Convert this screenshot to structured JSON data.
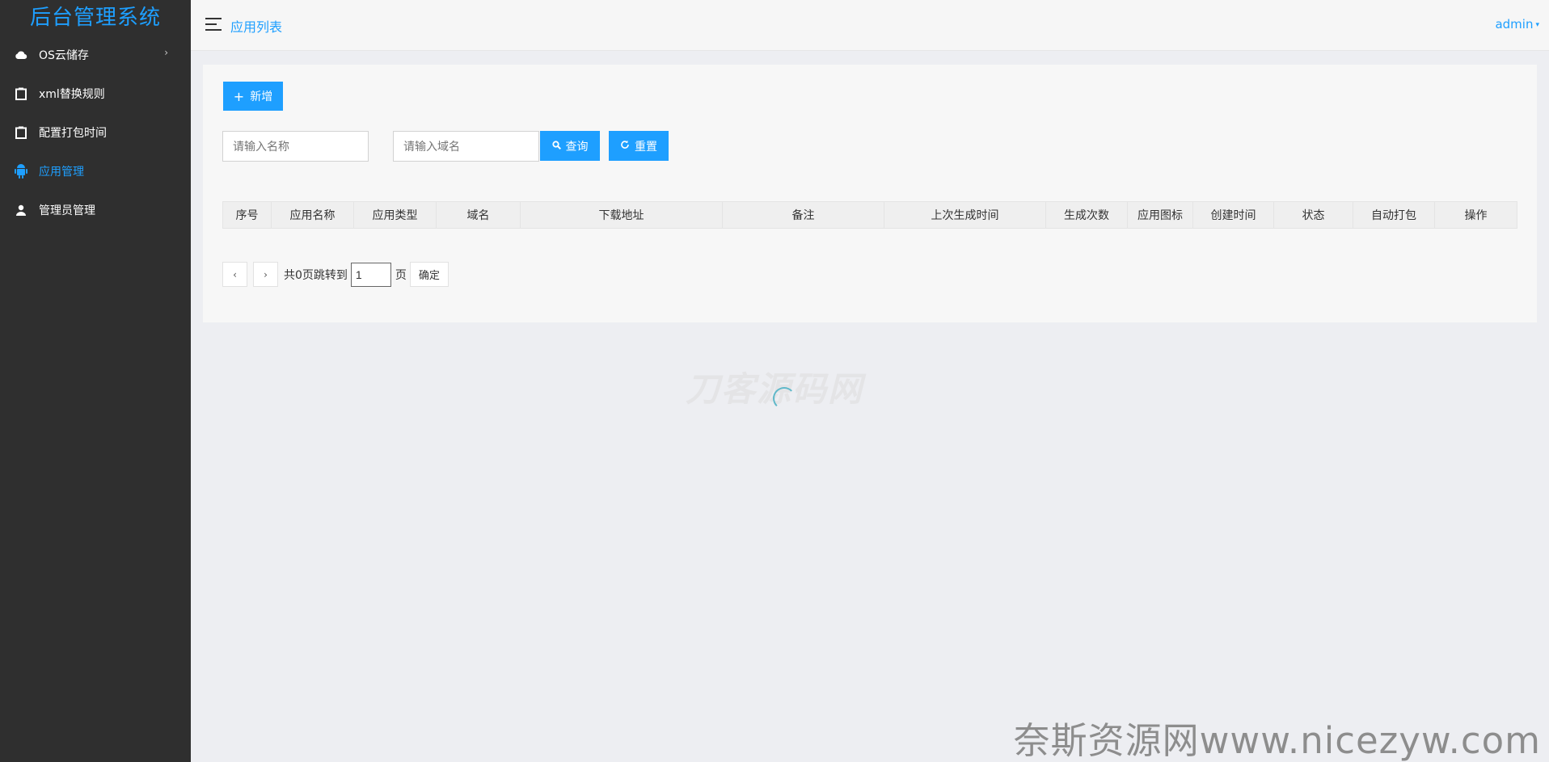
{
  "sidebar": {
    "brand": "后台管理系统",
    "items": [
      {
        "label": "OS云储存",
        "icon": "cloud-icon",
        "arrow": "›"
      },
      {
        "label": "xml替换规则",
        "icon": "clipboard-icon"
      },
      {
        "label": "配置打包时间",
        "icon": "clipboard-icon"
      },
      {
        "label": "应用管理",
        "icon": "android-icon",
        "active": true
      },
      {
        "label": "管理员管理",
        "icon": "user-icon"
      }
    ]
  },
  "header": {
    "breadcrumb": "应用列表",
    "user": "admin",
    "user_caret": "▾"
  },
  "toolbar": {
    "add_icon": "+",
    "add_label": "新增",
    "name_placeholder": "请输入名称",
    "domain_placeholder": "请输入域名",
    "search_label": "查询",
    "reset_label": "重置"
  },
  "table": {
    "columns": [
      "序号",
      "应用名称",
      "应用类型",
      "域名",
      "下载地址",
      "备注",
      "上次生成时间",
      "生成次数",
      "应用图标",
      "创建时间",
      "状态",
      "自动打包",
      "操作"
    ]
  },
  "pagination": {
    "prev": "‹",
    "next": "›",
    "total_text": "共0页跳转到",
    "page_value": "1",
    "page_suffix": "页",
    "confirm": "确定"
  },
  "watermark": {
    "center": "刀客源码网",
    "bottom": "奈斯资源网www.nicezyw.com"
  },
  "colors": {
    "accent": "#1e9fff",
    "sidebar_bg": "#2f2f2f"
  }
}
